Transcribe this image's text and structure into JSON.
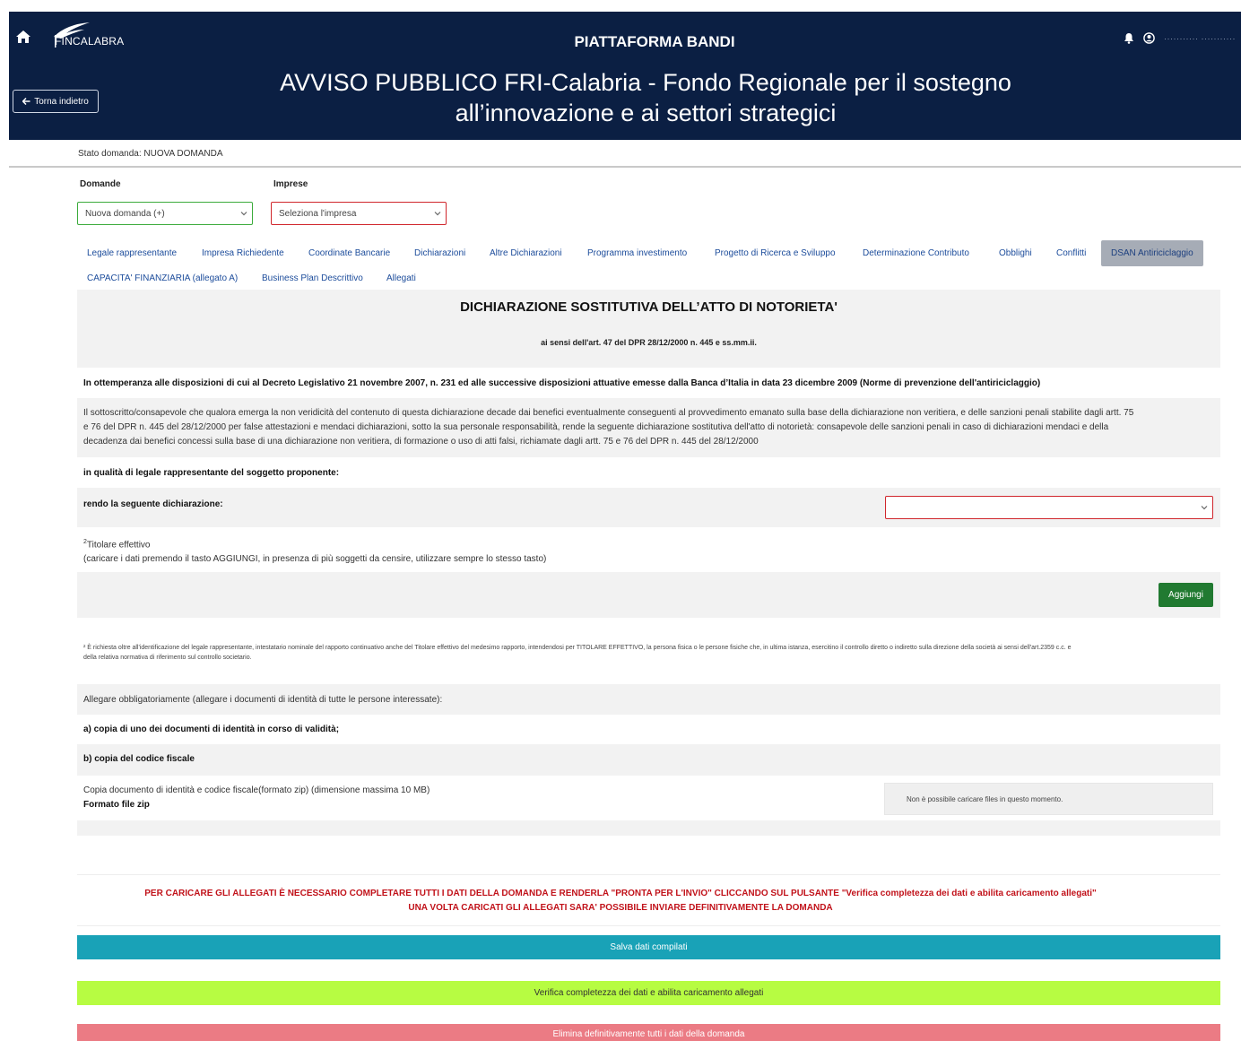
{
  "header": {
    "logo_text": "FINCALABRA",
    "platform_title": "PIATTAFORMA BANDI",
    "call_title_line1": "AVVISO PUBBLICO FRI-Calabria - Fondo Regionale per il sostegno",
    "call_title_line2": "all’innovazione e ai settori strategici",
    "back_label": "Torna indietro",
    "username": "··········· ···········",
    "bg_color": "#0b1f43"
  },
  "status": {
    "text": "Stato domanda: NUOVA DOMANDA"
  },
  "selectors": {
    "domande_label": "Domande",
    "domande_value": "Nuova domanda (+)",
    "imprese_label": "Imprese",
    "imprese_value": "Seleziona l'impresa"
  },
  "tabs": [
    {
      "label": "Legale rappresentante"
    },
    {
      "label": "Impresa Richiedente"
    },
    {
      "label": "Coordinate Bancarie"
    },
    {
      "label": "Dichiarazioni"
    },
    {
      "label": "Altre Dichiarazioni"
    },
    {
      "label": "Programma investimento"
    },
    {
      "label": "Progetto di Ricerca e Sviluppo"
    },
    {
      "label": "Determinazione Contributo"
    },
    {
      "label": "Obblighi"
    },
    {
      "label": "Conflitti"
    },
    {
      "label": "DSAN Antiriciclaggio",
      "active": true
    },
    {
      "label": "CAPACITA' FINANZIARIA (allegato A)"
    },
    {
      "label": "Business Plan Descrittivo"
    },
    {
      "label": "Allegati"
    }
  ],
  "form": {
    "title": "DICHIARAZIONE SOSTITUTIVA DELL’ATTO DI NOTORIETA'",
    "subtitle": "ai sensi dell'art. 47 del DPR 28/12/2000 n. 445 e ss.mm.ii.",
    "intro": "In ottemperanza alle disposizioni di cui al Decreto Legislativo 21 novembre 2007, n. 231 ed alle successive disposizioni attuative emesse dalla Banca d’Italia in data 23 dicembre 2009 (Norme di prevenzione dell'antiriciclaggio)",
    "body_line1": "Il sottoscritto/consapevole che qualora emerga la non veridicità del contenuto di questa dichiarazione decade dai benefici eventualmente conseguenti al provvedimento emanato sulla base della dichiarazione non veritiera, e delle sanzioni penali stabilite dagli artt. 75",
    "body_line2": "e 76 del DPR n. 445 del 28/12/2000 per false attestazioni e mendaci dichiarazioni, sotto la sua personale responsabilità, rende la seguente dichiarazione sostitutiva dell'atto di notorietà: consapevole delle sanzioni penali in caso di dichiarazioni mendaci e della",
    "body_line3": "decadenza dai benefici concessi sulla base di una dichiarazione non veritiera, di formazione o uso di atti falsi, richiamate dagli artt. 75 e 76 del DPR n. 445 del 28/12/2000",
    "qualita": "in qualità di legale rappresentante del soggetto proponente:",
    "rendo": "rendo la seguente dichiarazione:",
    "rendo_select_value": "",
    "titolare_sup": "2",
    "titolare": "Titolare effettivo",
    "titolare_note": "(caricare i dati premendo il tasto AGGIUNGI, in presenza di più soggetti da censire, utilizzare sempre lo stesso tasto)",
    "add_label": "Aggiungi",
    "footnote_line1": "² È richiesta oltre all'identificazione del legale rappresentante, intestatario nominale del rapporto continuativo anche del Titolare effettivo del medesimo rapporto, intendendosi per TITOLARE EFFETTIVO, la persona fisica o le persone fisiche che, in ultima istanza, esercitino il controllo diretto o indiretto sulla direzione della società ai sensi dell'art.2359 c.c. e",
    "footnote_line2": "della relativa normativa di riferimento sul controllo societario.",
    "allegare": "Allegare obbligatoriamente (allegare i documenti di identità di tutte le persone interessate):",
    "item_a": "a) copia di uno dei documenti di identità in corso di validità;",
    "item_b": "b) copia del codice fiscale",
    "upload_label": "Copia documento di identità e codice fiscale(formato zip) (dimensione massima 10 MB)",
    "upload_format": "Formato file zip",
    "upload_status": "Non è possibile caricare files in questo momento."
  },
  "warning": {
    "line1": "PER CARICARE GLI ALLEGATI È NECESSARIO COMPLETARE TUTTI I DATI DELLA DOMANDA E RENDERLA \"PRONTA PER L'INVIO\" CLICCANDO SUL PULSANTE \"Verifica completezza dei dati e abilita caricamento allegati\"",
    "line2": "UNA VOLTA CARICATI GLI ALLEGATI SARA' POSSIBILE INVIARE DEFINITIVAMENTE LA DOMANDA",
    "color": "#c1121a"
  },
  "actions": {
    "save": "Salva dati compilati",
    "verify": "Verifica completezza dei dati e abilita caricamento allegati",
    "delete": "Elimina definitivamente tutti i dati della domanda"
  }
}
